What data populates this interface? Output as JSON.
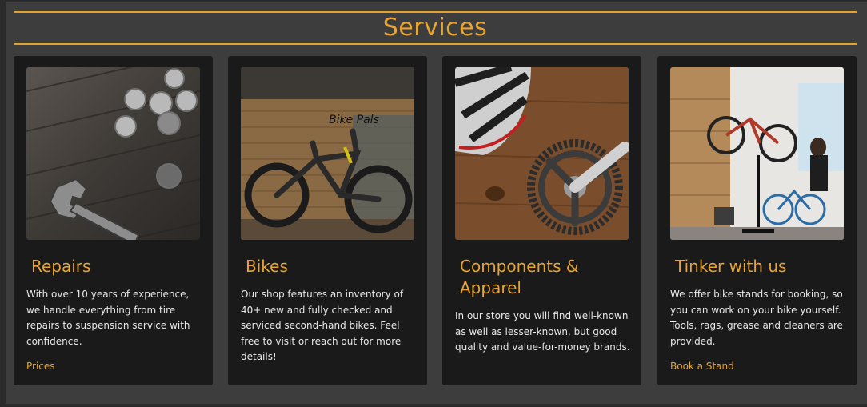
{
  "section": {
    "title": "Services"
  },
  "cards": [
    {
      "title": "Repairs",
      "description": "With over 10 years of experience, we handle everything from tire repairs to suspension service with confidence.",
      "link": "Prices",
      "image": "wrench-and-coins-photo"
    },
    {
      "title": "Bikes",
      "description": "Our shop features an inventory of 40+ new and fully checked and serviced second-hand bikes. Feel free to visit or reach out for more details!",
      "link": "",
      "image": "mountain-bike-photo",
      "image_text": "Bike Pals"
    },
    {
      "title": "Components & Apparel",
      "description": "In our store you will find well-known as well as lesser-known, but good quality and value-for-money brands.",
      "link": "",
      "image": "helmet-and-crankset-photo"
    },
    {
      "title": "Tinker with us",
      "description": "We offer bike stands for booking, so you can work on your bike yourself. Tools, rags, grease and cleaners are provided.",
      "link": "Book a Stand",
      "image": "workshop-stands-photo"
    }
  ],
  "colors": {
    "accent": "#e9a532",
    "background": "#3d3d3d",
    "card": "#1a1a1a"
  }
}
